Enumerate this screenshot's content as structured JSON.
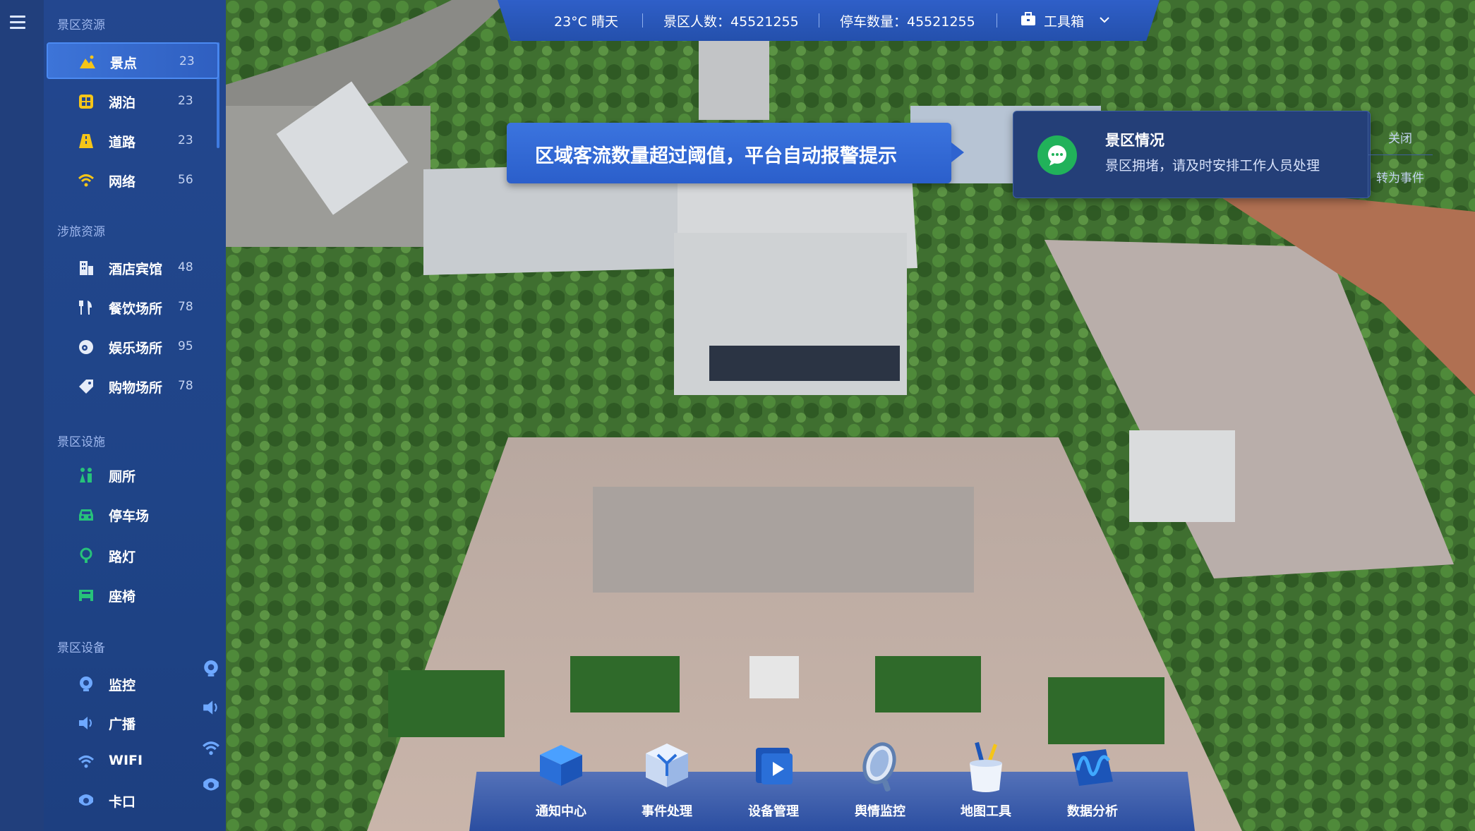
{
  "topbar": {
    "weather": "23°C  晴天",
    "visitors": "景区人数：45521255",
    "parking": "停车数量：45521255",
    "toolbox_label": "工具箱"
  },
  "sidebar": {
    "sections": [
      {
        "title": "景区资源",
        "items": [
          {
            "label": "景点",
            "count": "23",
            "icon": "mountain-icon",
            "active": true
          },
          {
            "label": "湖泊",
            "count": "23",
            "icon": "lake-icon"
          },
          {
            "label": "道路",
            "count": "23",
            "icon": "road-icon"
          },
          {
            "label": "网络",
            "count": "56",
            "icon": "wifi-icon"
          }
        ]
      },
      {
        "title": "涉旅资源",
        "items": [
          {
            "label": "酒店宾馆",
            "count": "48",
            "icon": "hotel-icon"
          },
          {
            "label": "餐饮场所",
            "count": "78",
            "icon": "dining-icon"
          },
          {
            "label": "娱乐场所",
            "count": "95",
            "icon": "entertainment-icon"
          },
          {
            "label": "购物场所",
            "count": "78",
            "icon": "shopping-icon"
          }
        ]
      },
      {
        "title": "景区设施",
        "items": [
          {
            "label": "厕所",
            "icon": "toilet-icon"
          },
          {
            "label": "停车场",
            "icon": "car-icon"
          },
          {
            "label": "路灯",
            "icon": "streetlight-icon"
          },
          {
            "label": "座椅",
            "icon": "bench-icon"
          }
        ]
      },
      {
        "title": "景区设备",
        "items": [
          {
            "label": "监控",
            "icon": "camera-icon"
          },
          {
            "label": "广播",
            "icon": "speaker-icon"
          },
          {
            "label": "WIFI",
            "icon": "wifi-icon"
          },
          {
            "label": "卡口",
            "icon": "checkpoint-icon"
          }
        ]
      }
    ]
  },
  "alert": {
    "text": "区域客流数量超过阈值，平台自动报警提示"
  },
  "notice": {
    "title": "景区情况",
    "message": "景区拥堵，请及时安排工作人员处理",
    "close_label": "关闭",
    "convert_label": "转为事件"
  },
  "dock": {
    "tools": [
      {
        "label": "通知中心",
        "icon": "notification-cube-icon"
      },
      {
        "label": "事件处理",
        "icon": "event-box-icon"
      },
      {
        "label": "设备管理",
        "icon": "device-play-icon"
      },
      {
        "label": "舆情监控",
        "icon": "magnifier-icon"
      },
      {
        "label": "地图工具",
        "icon": "pen-holder-icon"
      },
      {
        "label": "数据分析",
        "icon": "wave-chart-icon"
      }
    ]
  },
  "colors": {
    "accent": "#3b74df",
    "sidebar": "#23478f",
    "success": "#21b25a",
    "gold": "#f5c518"
  }
}
